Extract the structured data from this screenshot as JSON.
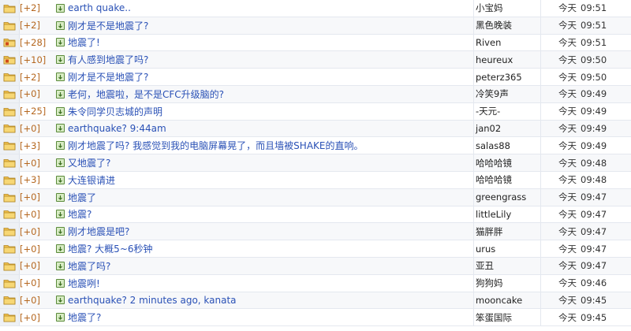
{
  "threads": [
    {
      "score": "[+2]",
      "title": "earth quake..",
      "author": "小宝妈",
      "day": "今天",
      "time": "09:51",
      "attach": "trash-icon",
      "folder": "normal"
    },
    {
      "score": "[+2]",
      "title": "刚才是不是地震了?",
      "author": "黑色晚装",
      "day": "今天",
      "time": "09:51",
      "attach": "",
      "folder": "normal"
    },
    {
      "score": "[+28]",
      "title": "地震了!",
      "author": "Riven",
      "day": "今天",
      "time": "09:51",
      "attach": "",
      "folder": "hot"
    },
    {
      "score": "[+10]",
      "title": "有人感到地震了吗?",
      "author": "heureux",
      "day": "今天",
      "time": "09:50",
      "attach": "paperclip-icon",
      "folder": "hot"
    },
    {
      "score": "[+2]",
      "title": "刚才是不是地震了?",
      "author": "peterz365",
      "day": "今天",
      "time": "09:50",
      "attach": "",
      "folder": "normal"
    },
    {
      "score": "[+0]",
      "title": "老何，地震啦，是不是CFC升级脑的?",
      "author": "冷笑9声",
      "day": "今天",
      "time": "09:49",
      "attach": "",
      "folder": "normal"
    },
    {
      "score": "[+25]",
      "title": "朱令同学贝志城的声明",
      "author": "-天元-",
      "day": "今天",
      "time": "09:49",
      "attach": "",
      "folder": "normal"
    },
    {
      "score": "[+0]",
      "title": "earthquake? 9:44am",
      "author": "jan02",
      "day": "今天",
      "time": "09:49",
      "attach": "",
      "folder": "normal"
    },
    {
      "score": "[+3]",
      "title": "刚才地震了吗? 我感觉到我的电脑屏幕晃了，而且墙被SHAKE的直响。",
      "author": "salas88",
      "day": "今天",
      "time": "09:49",
      "attach": "",
      "folder": "normal"
    },
    {
      "score": "[+0]",
      "title": "又地震了?",
      "author": "哈哈哈镜",
      "day": "今天",
      "time": "09:48",
      "attach": "",
      "folder": "normal"
    },
    {
      "score": "[+3]",
      "title": "大连银请进",
      "author": "哈哈哈镜",
      "day": "今天",
      "time": "09:48",
      "attach": "",
      "folder": "normal"
    },
    {
      "score": "[+0]",
      "title": "地震了",
      "author": "greengrass",
      "day": "今天",
      "time": "09:47",
      "attach": "",
      "folder": "normal"
    },
    {
      "score": "[+0]",
      "title": "地震?",
      "author": "littleLily",
      "day": "今天",
      "time": "09:47",
      "attach": "",
      "folder": "normal"
    },
    {
      "score": "[+0]",
      "title": "刚才地震是吧?",
      "author": "猫胖胖",
      "day": "今天",
      "time": "09:47",
      "attach": "",
      "folder": "normal"
    },
    {
      "score": "[+0]",
      "title": "地震? 大概5~6秒钟",
      "author": "urus",
      "day": "今天",
      "time": "09:47",
      "attach": "",
      "folder": "normal"
    },
    {
      "score": "[+0]",
      "title": "地震了吗?",
      "author": "亚丑",
      "day": "今天",
      "time": "09:47",
      "attach": "",
      "folder": "normal"
    },
    {
      "score": "[+0]",
      "title": "地震咧!",
      "author": "狗狗妈",
      "day": "今天",
      "time": "09:46",
      "attach": "",
      "folder": "normal"
    },
    {
      "score": "[+0]",
      "title": "earthquake? 2 minutes ago, kanata",
      "author": "mooncake",
      "day": "今天",
      "time": "09:45",
      "attach": "",
      "folder": "normal"
    },
    {
      "score": "[+0]",
      "title": "地震了?",
      "author": "笨蛋国际",
      "day": "今天",
      "time": "09:45",
      "attach": "",
      "folder": "normal"
    }
  ],
  "icons": {
    "folder": "folder-icon",
    "hot_folder": "hot-folder-icon",
    "post_mark": "post-mark-icon"
  },
  "colors": {
    "title": "#2a51b6",
    "score": "#b5671f",
    "folder": "#f2c24e"
  }
}
